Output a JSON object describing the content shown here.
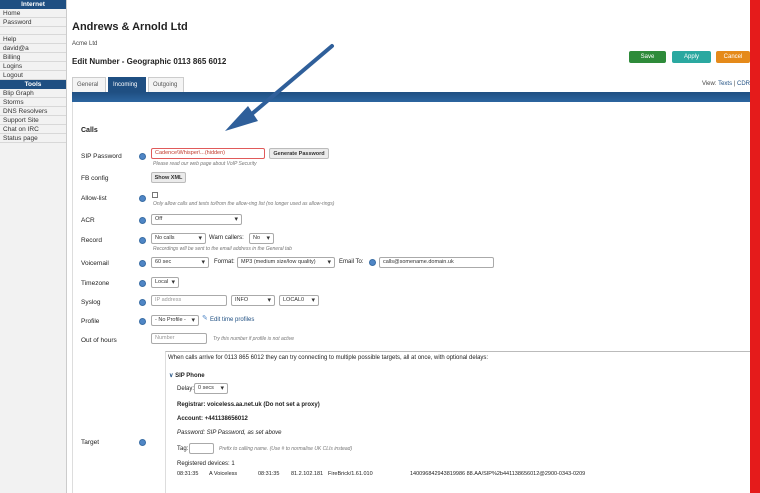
{
  "sidebar": {
    "sections": [
      {
        "header": "Internet",
        "items": [
          "Home",
          "Password"
        ]
      },
      {
        "header": null,
        "items": [
          "Help",
          "david@a",
          "Billing",
          "Logins",
          "Logout"
        ]
      },
      {
        "header": "Tools",
        "items": [
          "Blip Graph",
          "Storms",
          "DNS Resolvers",
          "Support Site",
          "Chat on IRC",
          "Status page"
        ]
      }
    ]
  },
  "header": {
    "company": "Andrews & Arnold Ltd",
    "account": "Acme Ltd",
    "edit_title": "Edit Number - Geographic 0113 865 6012",
    "save": "Save",
    "apply": "Apply",
    "cancel": "Cancel"
  },
  "tabs": [
    {
      "label": "General",
      "active": false
    },
    {
      "label": "Incoming",
      "active": true
    },
    {
      "label": "Outgoing",
      "active": false
    }
  ],
  "view": {
    "prefix": "View:",
    "texts": "Texts",
    "sep": "|",
    "cdr": "CDR"
  },
  "form": {
    "section_title": "Calls",
    "sip_password": {
      "label": "SIP Password",
      "value": "Cadence\\Whisper\\...(hidden)",
      "generate": "Generate Password",
      "note": "Please read our web page about VoIP Security"
    },
    "fb_config": {
      "label": "FB config",
      "button": "Show XML"
    },
    "allow_list": {
      "label": "Allow-list",
      "note": "Only allow calls and texts to/from the allow-ring list (no longer used as allow-rings)"
    },
    "acr": {
      "label": "ACR",
      "value": "Off"
    },
    "record": {
      "label": "Record",
      "value": "No calls",
      "warn_label": "Warn callers:",
      "warn_value": "No",
      "note": "Recordings will be sent to the email address in the General tab"
    },
    "voicemail": {
      "label": "Voicemail",
      "value": "60 sec",
      "format_label": "Format:",
      "format_value": "MP3 (medium size/low quality)",
      "email_label": "Email To:",
      "email_value": "calls@somename.domain.uk"
    },
    "timezone": {
      "label": "Timezone",
      "value": "Local"
    },
    "syslog": {
      "label": "Syslog",
      "placeholder": "IP address",
      "level": "INFO",
      "facility": "LOCAL0"
    },
    "profile": {
      "label": "Profile",
      "value": "- No Profile -",
      "edit_link": "Edit time profiles"
    },
    "out_of_hours": {
      "label": "Out of hours",
      "placeholder": "Number",
      "note": "Try this number if profile is not active"
    },
    "target": {
      "label": "Target",
      "intro": "When calls arrive for 0113 865 6012 they can try connecting to multiple possible targets, all at once, with optional delays:",
      "sip_phone": "SIP Phone",
      "delay_label": "Delay:",
      "delay_value": "0 secs",
      "registrar": "Registrar: voiceless.aa.net.uk (Do not set a proxy)",
      "account": "Account: +441138656012",
      "password": "Password: SIP Password, as set above",
      "tag_label": "Tag:",
      "tag_note": "Prefix to calling name. (Use # to normalise UK CLIs instead)",
      "registered": "Registered devices: 1",
      "device": {
        "time1": "08:31:35",
        "agent": "A Voiceless",
        "time2": "08:31:35",
        "ip": "81.2.102.181",
        "client": "FireBrick/1.61.010",
        "id": "140096842943819986 88.AA/SIP%2b441138656012@2900-0343-0209"
      }
    }
  },
  "colors": {
    "brand_blue": "#1f4f82",
    "save": "#2e8b3a",
    "apply": "#2aa8a0",
    "cancel": "#e58a1a",
    "arrow": "#2f5f9a",
    "red_edge": "#e51b1b"
  },
  "icons": {
    "help": "help-circle-icon",
    "edit": "pencil-icon",
    "arrow": "annotation-arrow-icon"
  }
}
